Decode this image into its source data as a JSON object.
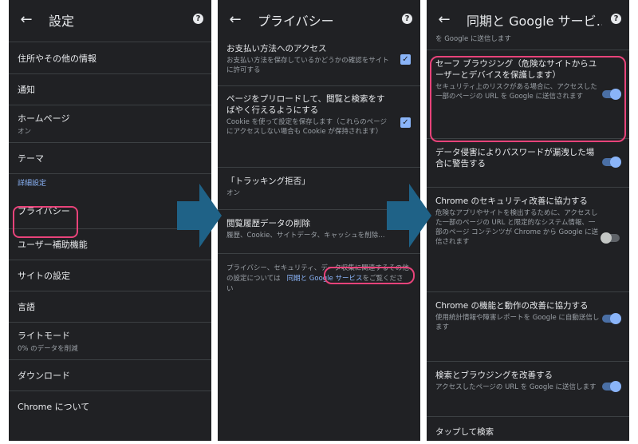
{
  "panel1": {
    "title": "設定",
    "items": [
      {
        "label": "住所やその他の情報"
      },
      {
        "label": "通知"
      },
      {
        "label": "ホームページ",
        "sub": "オン"
      },
      {
        "label": "テーマ"
      }
    ],
    "section": "詳細設定",
    "items2": [
      {
        "label": "プライバシー"
      },
      {
        "label": "ユーザー補助機能"
      },
      {
        "label": "サイトの設定"
      },
      {
        "label": "言語"
      },
      {
        "label": "ライトモード",
        "sub": "0% のデータを削減"
      },
      {
        "label": "ダウンロード"
      },
      {
        "label": "Chrome について"
      }
    ]
  },
  "panel2": {
    "title": "プライバシー",
    "rows": [
      {
        "title": "お支払い方法へのアクセス",
        "sub": "お支払い方法を保存しているかどうかの確認をサイトに許可する"
      },
      {
        "title": "ページをプリロードして、閲覧と検索をすばやく行えるようにする",
        "sub": "Cookie を使って設定を保存します（これらのページにアクセスしない場合も Cookie が保持されます）"
      },
      {
        "title": "「トラッキング拒否」",
        "sub": "オン"
      },
      {
        "title": "閲覧履歴データの削除",
        "sub": "履歴、Cookie、サイトデータ、キャッシュを削除…"
      }
    ],
    "footer_text": "プライバシー、セキュリティ、データ収集に関連するその他の設定については",
    "footer_link": "同期と Google サービス",
    "footer_tail": "をご覧ください"
  },
  "panel3": {
    "title": "同期と Google サービ…",
    "top_text": "を Google に送信します",
    "rows": [
      {
        "title": "セーフ ブラウジング（危険なサイトからユーザーとデバイスを保護します）",
        "sub": "セキュリティ上のリスクがある場合に、アクセスした一部のページの URL を Google に送信されます",
        "on": true
      },
      {
        "title": "データ侵害によりパスワードが漏洩した場合に警告する",
        "sub": "",
        "on": true
      },
      {
        "title": "Chrome のセキュリティ改善に協力する",
        "sub": "危険なアプリやサイトを検出するために、アクセスした一部のページの URL と限定的なシステム情報、一部のページ コンテンツが Chrome から Google に送信されます",
        "on": false
      },
      {
        "title": "Chrome の機能と動作の改善に協力する",
        "sub": "使用統計情報や障害レポートを Google に自動送信します",
        "on": true
      },
      {
        "title": "検索とブラウジングを改善する",
        "sub": "アクセスしたページの URL を Google に送信します",
        "on": true
      }
    ],
    "bottom_item": "タップして検索"
  },
  "colors": {
    "bg": "#202124",
    "accent": "#8ab4f8",
    "highlight": "#e8437a",
    "arrow": "#1f6287"
  }
}
